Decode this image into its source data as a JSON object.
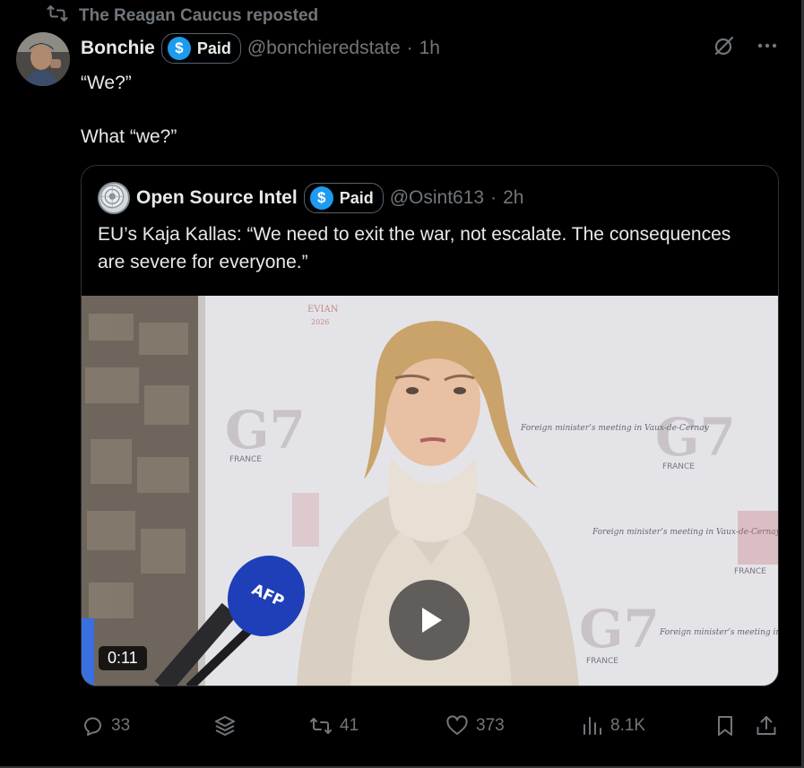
{
  "repost": {
    "label": "The Reagan Caucus reposted"
  },
  "tweet": {
    "name": "Bonchie",
    "badge": "Paid",
    "badge_symbol": "$",
    "handle": "@bonchieredstate",
    "separator": "·",
    "time": "1h",
    "lines": [
      "“We?”",
      "What “we?”"
    ]
  },
  "quote": {
    "name": "Open Source Intel",
    "badge": "Paid",
    "badge_symbol": "$",
    "handle": "@Osint613",
    "separator": "·",
    "time": "2h",
    "text": "EU’s Kaja Kallas:  “We need to exit the war, not escalate. The consequences are severe for everyone.”",
    "video": {
      "duration": "0:11",
      "backdrop_text": {
        "g7": "G7",
        "country": "FRANCE",
        "meeting": "Foreign minister’s meeting in Vaux-de-Cernay",
        "evian": "EVIAN",
        "year": "2026",
        "mic": "AFP"
      }
    }
  },
  "actions": {
    "replies": "33",
    "reposts": "41",
    "likes": "373",
    "views": "8.1K"
  },
  "colors": {
    "background": "#000000",
    "text": "#e7e9ea",
    "muted": "#71767b",
    "accent": "#1d9bf0",
    "border": "#2f3336"
  },
  "icons": [
    "repost-icon",
    "grok-icon",
    "more-icon",
    "reply-icon",
    "stack-icon",
    "like-icon",
    "views-icon",
    "bookmark-icon",
    "share-icon",
    "play-icon"
  ]
}
